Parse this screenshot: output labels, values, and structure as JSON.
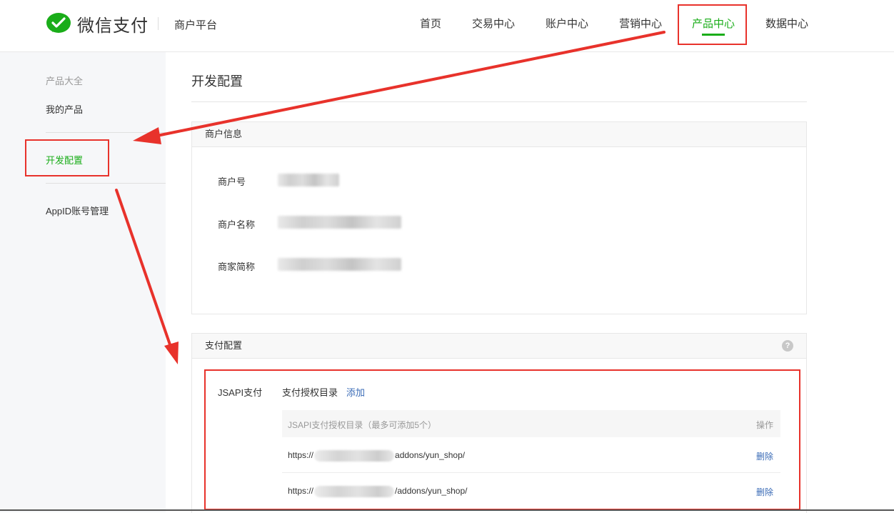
{
  "header": {
    "brand": "微信支付",
    "platform": "商户平台",
    "nav": [
      {
        "label": "首页"
      },
      {
        "label": "交易中心"
      },
      {
        "label": "账户中心"
      },
      {
        "label": "营销中心"
      },
      {
        "label": "产品中心",
        "active": true
      },
      {
        "label": "数据中心"
      }
    ]
  },
  "sidebar": {
    "group_title": "产品大全",
    "items": [
      {
        "label": "我的产品"
      },
      {
        "label": "开发配置",
        "active": true
      },
      {
        "label": "AppID账号管理"
      }
    ]
  },
  "main": {
    "title": "开发配置",
    "merchant_panel": {
      "title": "商户信息",
      "fields": [
        {
          "label": "商户号"
        },
        {
          "label": "商户名称"
        },
        {
          "label": "商家简称"
        }
      ]
    },
    "payment_panel": {
      "title": "支付配置",
      "help": "?",
      "jsapi_label": "JSAPI支付",
      "auth_label": "支付授权目录",
      "add_label": "添加",
      "table": {
        "header_dir": "JSAPI支付授权目录（最多可添加5个）",
        "header_op": "操作",
        "rows": [
          {
            "prefix": "https://",
            "suffix": "addons/yun_shop/",
            "action": "删除"
          },
          {
            "prefix": "https://",
            "suffix": "/addons/yun_shop/",
            "action": "删除"
          }
        ]
      }
    }
  },
  "colors": {
    "accent": "#1aad19",
    "link": "#3a6bb6",
    "annotation": "#e8322b"
  }
}
